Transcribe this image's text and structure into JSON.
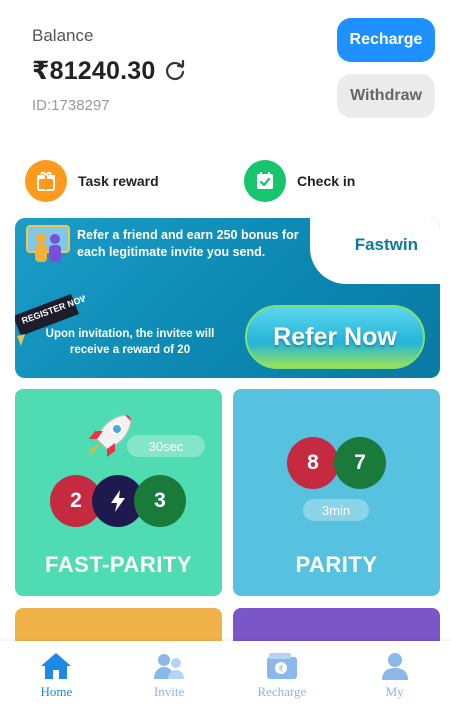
{
  "header": {
    "balance_label": "Balance",
    "balance_amount": "₹81240.30",
    "user_id": "ID:1738297",
    "recharge_label": "Recharge",
    "withdraw_label": "Withdraw"
  },
  "quick_actions": {
    "task_label": "Task reward",
    "checkin_label": "Check in"
  },
  "banner": {
    "line1": "Refer a friend and earn 250 bonus for each legitimate invite you send.",
    "brand": "Fastwin",
    "line2": "Upon invitation, the invitee will receive a reward of 20",
    "register_tag": "REGISTER NOW!",
    "cta": "Refer Now"
  },
  "games": {
    "fast_parity": {
      "title": "FAST-PARITY",
      "timer": "30sec",
      "balls": [
        "2",
        "",
        "3"
      ]
    },
    "parity": {
      "title": "PARITY",
      "timer": "3min",
      "balls": [
        "8",
        "7"
      ]
    }
  },
  "nav": {
    "items": [
      {
        "label": "Home",
        "icon": "home-icon",
        "active": true
      },
      {
        "label": "Invite",
        "icon": "invite-icon",
        "active": false
      },
      {
        "label": "Recharge",
        "icon": "wallet-icon",
        "active": false
      },
      {
        "label": "My",
        "icon": "user-icon",
        "active": false
      }
    ]
  },
  "colors": {
    "primary": "#1e90ff",
    "fast_parity_card": "#4fdcb2",
    "parity_card": "#56c2df",
    "ball_red": "#c62a40",
    "ball_green": "#1a7a3a",
    "ball_navy": "#1e1a4e"
  }
}
